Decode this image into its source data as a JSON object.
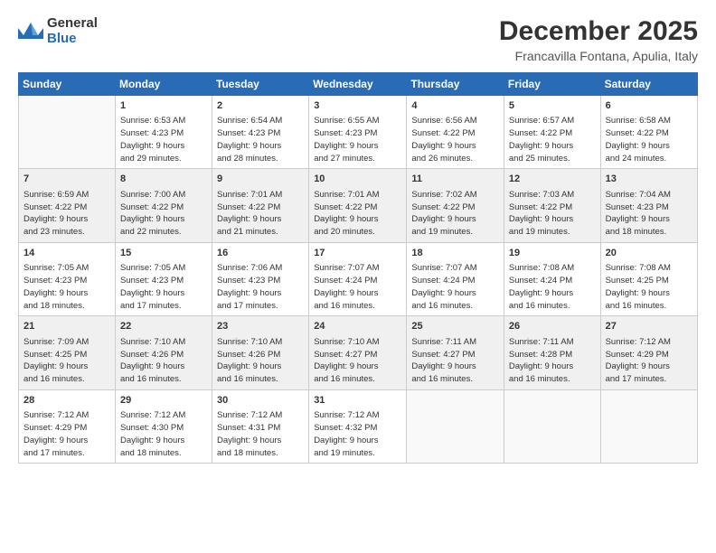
{
  "logo": {
    "general": "General",
    "blue": "Blue"
  },
  "title": "December 2025",
  "location": "Francavilla Fontana, Apulia, Italy",
  "headers": [
    "Sunday",
    "Monday",
    "Tuesday",
    "Wednesday",
    "Thursday",
    "Friday",
    "Saturday"
  ],
  "weeks": [
    [
      {
        "day": "",
        "info": ""
      },
      {
        "day": "1",
        "info": "Sunrise: 6:53 AM\nSunset: 4:23 PM\nDaylight: 9 hours\nand 29 minutes."
      },
      {
        "day": "2",
        "info": "Sunrise: 6:54 AM\nSunset: 4:23 PM\nDaylight: 9 hours\nand 28 minutes."
      },
      {
        "day": "3",
        "info": "Sunrise: 6:55 AM\nSunset: 4:23 PM\nDaylight: 9 hours\nand 27 minutes."
      },
      {
        "day": "4",
        "info": "Sunrise: 6:56 AM\nSunset: 4:22 PM\nDaylight: 9 hours\nand 26 minutes."
      },
      {
        "day": "5",
        "info": "Sunrise: 6:57 AM\nSunset: 4:22 PM\nDaylight: 9 hours\nand 25 minutes."
      },
      {
        "day": "6",
        "info": "Sunrise: 6:58 AM\nSunset: 4:22 PM\nDaylight: 9 hours\nand 24 minutes."
      }
    ],
    [
      {
        "day": "7",
        "info": "Sunrise: 6:59 AM\nSunset: 4:22 PM\nDaylight: 9 hours\nand 23 minutes."
      },
      {
        "day": "8",
        "info": "Sunrise: 7:00 AM\nSunset: 4:22 PM\nDaylight: 9 hours\nand 22 minutes."
      },
      {
        "day": "9",
        "info": "Sunrise: 7:01 AM\nSunset: 4:22 PM\nDaylight: 9 hours\nand 21 minutes."
      },
      {
        "day": "10",
        "info": "Sunrise: 7:01 AM\nSunset: 4:22 PM\nDaylight: 9 hours\nand 20 minutes."
      },
      {
        "day": "11",
        "info": "Sunrise: 7:02 AM\nSunset: 4:22 PM\nDaylight: 9 hours\nand 19 minutes."
      },
      {
        "day": "12",
        "info": "Sunrise: 7:03 AM\nSunset: 4:22 PM\nDaylight: 9 hours\nand 19 minutes."
      },
      {
        "day": "13",
        "info": "Sunrise: 7:04 AM\nSunset: 4:23 PM\nDaylight: 9 hours\nand 18 minutes."
      }
    ],
    [
      {
        "day": "14",
        "info": "Sunrise: 7:05 AM\nSunset: 4:23 PM\nDaylight: 9 hours\nand 18 minutes."
      },
      {
        "day": "15",
        "info": "Sunrise: 7:05 AM\nSunset: 4:23 PM\nDaylight: 9 hours\nand 17 minutes."
      },
      {
        "day": "16",
        "info": "Sunrise: 7:06 AM\nSunset: 4:23 PM\nDaylight: 9 hours\nand 17 minutes."
      },
      {
        "day": "17",
        "info": "Sunrise: 7:07 AM\nSunset: 4:24 PM\nDaylight: 9 hours\nand 16 minutes."
      },
      {
        "day": "18",
        "info": "Sunrise: 7:07 AM\nSunset: 4:24 PM\nDaylight: 9 hours\nand 16 minutes."
      },
      {
        "day": "19",
        "info": "Sunrise: 7:08 AM\nSunset: 4:24 PM\nDaylight: 9 hours\nand 16 minutes."
      },
      {
        "day": "20",
        "info": "Sunrise: 7:08 AM\nSunset: 4:25 PM\nDaylight: 9 hours\nand 16 minutes."
      }
    ],
    [
      {
        "day": "21",
        "info": "Sunrise: 7:09 AM\nSunset: 4:25 PM\nDaylight: 9 hours\nand 16 minutes."
      },
      {
        "day": "22",
        "info": "Sunrise: 7:10 AM\nSunset: 4:26 PM\nDaylight: 9 hours\nand 16 minutes."
      },
      {
        "day": "23",
        "info": "Sunrise: 7:10 AM\nSunset: 4:26 PM\nDaylight: 9 hours\nand 16 minutes."
      },
      {
        "day": "24",
        "info": "Sunrise: 7:10 AM\nSunset: 4:27 PM\nDaylight: 9 hours\nand 16 minutes."
      },
      {
        "day": "25",
        "info": "Sunrise: 7:11 AM\nSunset: 4:27 PM\nDaylight: 9 hours\nand 16 minutes."
      },
      {
        "day": "26",
        "info": "Sunrise: 7:11 AM\nSunset: 4:28 PM\nDaylight: 9 hours\nand 16 minutes."
      },
      {
        "day": "27",
        "info": "Sunrise: 7:12 AM\nSunset: 4:29 PM\nDaylight: 9 hours\nand 17 minutes."
      }
    ],
    [
      {
        "day": "28",
        "info": "Sunrise: 7:12 AM\nSunset: 4:29 PM\nDaylight: 9 hours\nand 17 minutes."
      },
      {
        "day": "29",
        "info": "Sunrise: 7:12 AM\nSunset: 4:30 PM\nDaylight: 9 hours\nand 18 minutes."
      },
      {
        "day": "30",
        "info": "Sunrise: 7:12 AM\nSunset: 4:31 PM\nDaylight: 9 hours\nand 18 minutes."
      },
      {
        "day": "31",
        "info": "Sunrise: 7:12 AM\nSunset: 4:32 PM\nDaylight: 9 hours\nand 19 minutes."
      },
      {
        "day": "",
        "info": ""
      },
      {
        "day": "",
        "info": ""
      },
      {
        "day": "",
        "info": ""
      }
    ]
  ]
}
